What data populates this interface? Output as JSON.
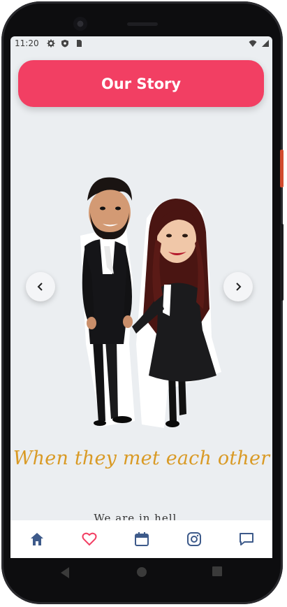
{
  "status_bar": {
    "time": "11:20",
    "left_icons": [
      "gear-icon",
      "shield-icon",
      "sim-icon"
    ],
    "right_icons": [
      "wifi-icon",
      "signal-icon"
    ]
  },
  "header": {
    "title_button_label": "Our Story",
    "accent_color": "#f23f63"
  },
  "carousel": {
    "prev_icon": "chevron-left-icon",
    "next_icon": "chevron-right-icon",
    "image": "couple-caricature"
  },
  "content": {
    "heading": "When they met each other",
    "heading_color": "#d99a25",
    "subtext": "We are in hell..."
  },
  "bottom_nav": {
    "items": [
      {
        "icon": "home-icon",
        "active": true
      },
      {
        "icon": "heart-icon"
      },
      {
        "icon": "calendar-icon"
      },
      {
        "icon": "instagram-icon"
      },
      {
        "icon": "chat-icon"
      }
    ]
  },
  "system_nav": {
    "items": [
      "back-icon",
      "home-circle-icon",
      "recents-icon"
    ]
  }
}
